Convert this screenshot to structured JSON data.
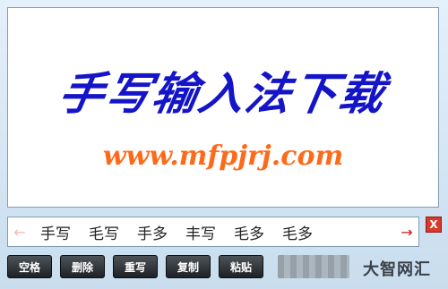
{
  "canvas": {
    "headline": "手写输入法下载",
    "url": "www.mfpjrj.com"
  },
  "candidate_bar": {
    "left_arrow": "←",
    "right_arrow": "→",
    "candidates": [
      "手写",
      "毛写",
      "手多",
      "丰写",
      "毛多",
      "毛多"
    ]
  },
  "close_button": {
    "label": "X"
  },
  "buttons": {
    "space": "空格",
    "delete": "删除",
    "rewrite": "重写",
    "copy": "复制",
    "paste": "粘贴"
  },
  "watermark": "大智网汇",
  "colors": {
    "headline": "#1414c8",
    "url": "#ff6a1a",
    "close": "#d93a2b",
    "button": "#2a2e33"
  }
}
